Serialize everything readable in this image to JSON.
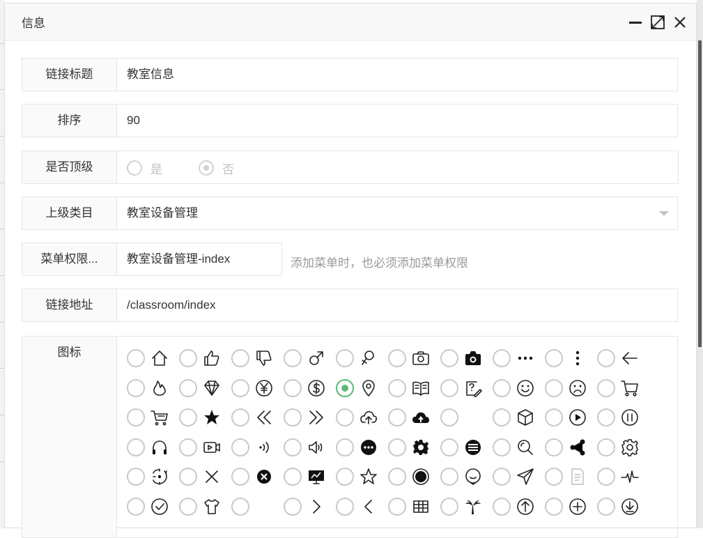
{
  "dialog": {
    "title": "信息",
    "controls": {
      "minimize": "minimize-icon",
      "maximize": "maximize-icon",
      "close": "close-icon"
    }
  },
  "form": {
    "link_title": {
      "label": "链接标题",
      "value": "教室信息"
    },
    "order": {
      "label": "排序",
      "value": "90"
    },
    "is_top": {
      "label": "是否顶级",
      "options": [
        "是",
        "否"
      ],
      "selected": "否"
    },
    "parent": {
      "label": "上级类目",
      "value": "教室设备管理"
    },
    "permission": {
      "label": "菜单权限...",
      "value": "教室设备管理-index",
      "hint": "添加菜单时，也必须添加菜单权限"
    },
    "url": {
      "label": "链接地址",
      "value": "/classroom/index"
    },
    "icon": {
      "label": "图标",
      "selected_index": 14,
      "icons": [
        "home-icon",
        "thumbs-up-icon",
        "thumbs-down-icon",
        "male-icon",
        "female-icon",
        "camera-outline-icon",
        "camera-icon",
        "more-horizontal-icon",
        "more-vertical-icon",
        "arrow-left-icon",
        "fire-icon",
        "diamond-icon",
        "yuan-icon",
        "dollar-icon",
        "location-icon",
        "book-icon",
        "note-edit-icon",
        "smile-icon",
        "sad-icon",
        "cart-icon",
        "cart-simple-icon",
        "star-icon",
        "double-left-icon",
        "double-right-icon",
        "upload-cloud-icon",
        "cloud-icon",
        "blank-icon",
        "cube-icon",
        "play-icon",
        "pause-icon",
        "headset-icon",
        "video-icon",
        "sound-waves-icon",
        "volume-icon",
        "chat-bubble-icon",
        "gear-icon",
        "menu-circle-icon",
        "search-icon",
        "share-icon",
        "settings-icon",
        "refresh-dot-icon",
        "close-thin-icon",
        "close-circle-icon",
        "presentation-icon",
        "star-outline-icon",
        "record-icon",
        "chat-outline-icon",
        "send-icon",
        "document-icon",
        "pulse-icon",
        "check-circle-icon",
        "shirt-icon",
        "blank-icon",
        "chevron-right-icon",
        "chevron-left-icon",
        "table-icon",
        "palm-tree-icon",
        "up-circle-icon",
        "plus-circle-icon",
        "download-circle-icon"
      ]
    }
  },
  "colors": {
    "accent": "#5fb878",
    "border": "#e6e6e6",
    "label_bg": "#fafafa"
  }
}
